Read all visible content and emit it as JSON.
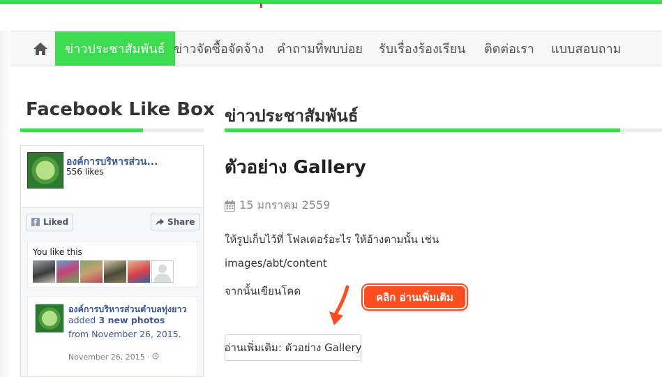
{
  "colors": {
    "accent": "#3ddc50",
    "facebook_blue": "#3b5998",
    "annotation": "#ff4d1f",
    "top_mark": "#e0302a"
  },
  "nav": {
    "home_icon": "home-icon",
    "items": [
      {
        "label": "ข่าวประชาสัมพันธ์",
        "active": true
      },
      {
        "label": "ข่าวจัดซื้อจัดจ้าง",
        "active": false
      },
      {
        "label": "คำถามที่พบบ่อย",
        "active": false
      },
      {
        "label": "รับเรื่องร้องเรียน",
        "active": false
      },
      {
        "label": "ติดต่อเรา",
        "active": false
      },
      {
        "label": "แบบสอบถาม",
        "active": false
      }
    ]
  },
  "sidebar": {
    "heading": "Facebook Like Box",
    "facebook": {
      "page_name": "องค์การบริหารส่วน...",
      "likes": "556 likes",
      "liked_label": "Liked",
      "share_label": "Share",
      "you_like_label": "You like this",
      "friend_count": 6,
      "post": {
        "author": "องค์การบริหารส่วนตำบลทุ่งยาว",
        "action": "added",
        "photos_link": "3 new photos",
        "from_text": "from November 26, 2015.",
        "date": "November 26, 2015 ·"
      }
    }
  },
  "main": {
    "section_heading": "ข่าวประชาสัมพันธ์",
    "article": {
      "title": "ตัวอย่าง Gallery",
      "date": "15 มกราคม 2559",
      "paragraphs": [
        "ให้รูปเก็บไว้ที่ โฟลเดอร์อะไร ให้อ้างตามนั้น เช่น",
        "images/abt/content",
        "จากนั้นเขียนโคด"
      ],
      "readmore_label": "อ่านเพิ่มเติม: ตัวอย่าง Gallery"
    },
    "annotation_label": "คลิก อ่านเพิ่มเติม"
  }
}
